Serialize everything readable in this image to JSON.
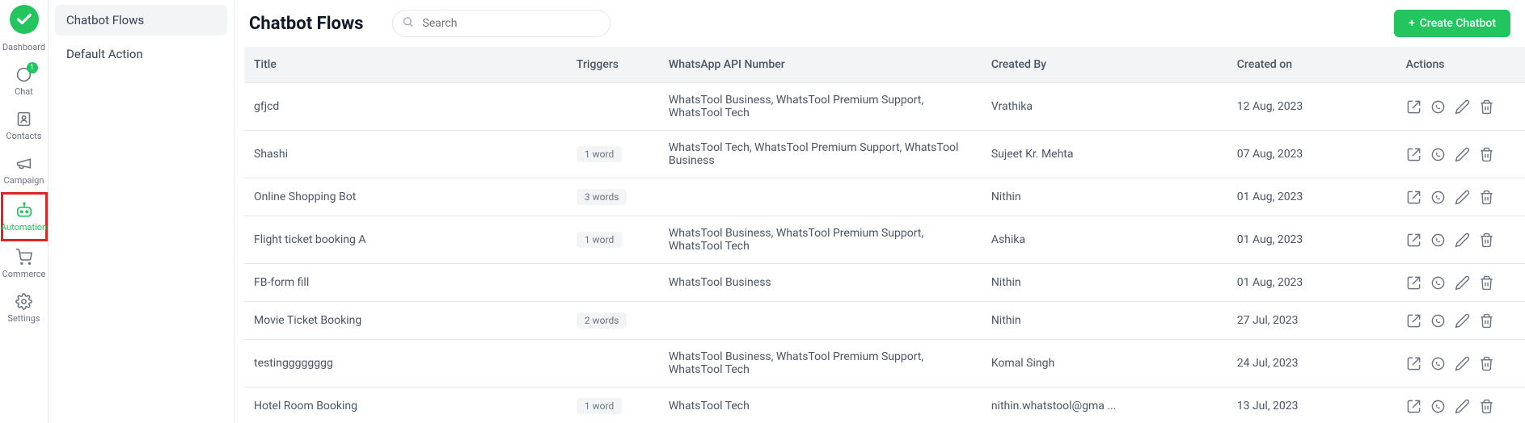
{
  "nav": {
    "items": [
      {
        "key": "dashboard",
        "label": "Dashboard"
      },
      {
        "key": "chat",
        "label": "Chat",
        "badge": "1"
      },
      {
        "key": "contacts",
        "label": "Contacts"
      },
      {
        "key": "campaign",
        "label": "Campaign"
      },
      {
        "key": "automation",
        "label": "Automation",
        "active": true
      },
      {
        "key": "commerce",
        "label": "Commerce"
      },
      {
        "key": "settings",
        "label": "Settings"
      }
    ]
  },
  "subnav": {
    "items": [
      {
        "label": "Chatbot Flows",
        "selected": true
      },
      {
        "label": "Default Action"
      }
    ]
  },
  "header": {
    "title": "Chatbot Flows",
    "search_placeholder": "Search",
    "create_label": "Create Chatbot"
  },
  "table": {
    "columns": {
      "title": "Title",
      "triggers": "Triggers",
      "api": "WhatsApp API Number",
      "by": "Created By",
      "on": "Created on",
      "actions": "Actions"
    },
    "rows": [
      {
        "title": "gfjcd",
        "triggers": "",
        "api": "WhatsTool Business, WhatsTool Premium Support, WhatsTool Tech",
        "by": "Vrathika",
        "on": "12 Aug, 2023"
      },
      {
        "title": "Shashi",
        "triggers": "1 word",
        "api": "WhatsTool Tech, WhatsTool Premium Support, WhatsTool Business",
        "by": "Sujeet Kr. Mehta",
        "on": "07 Aug, 2023"
      },
      {
        "title": "Online Shopping Bot",
        "triggers": "3 words",
        "api": "",
        "by": "Nithin",
        "on": "01 Aug, 2023"
      },
      {
        "title": "Flight ticket booking A",
        "triggers": "1 word",
        "api": "WhatsTool Business, WhatsTool Premium Support, WhatsTool Tech",
        "by": "Ashika",
        "on": "01 Aug, 2023"
      },
      {
        "title": "FB-form fill",
        "triggers": "",
        "api": "WhatsTool Business",
        "by": "Nithin",
        "on": "01 Aug, 2023"
      },
      {
        "title": "Movie Ticket Booking",
        "triggers": "2 words",
        "api": "",
        "by": "Nithin",
        "on": "27 Jul, 2023"
      },
      {
        "title": "testingggggggg",
        "triggers": "",
        "api": "WhatsTool Business, WhatsTool Premium Support, WhatsTool Tech",
        "by": "Komal Singh",
        "on": "24 Jul, 2023"
      },
      {
        "title": "Hotel Room Booking",
        "triggers": "1 word",
        "api": "WhatsTool Tech",
        "by": "nithin.whatstool@gma ...",
        "on": "13 Jul, 2023"
      }
    ]
  }
}
